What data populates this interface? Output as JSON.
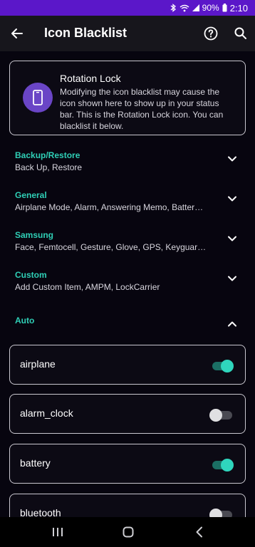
{
  "status": {
    "battery_percent": "90%",
    "time": "2:10",
    "icons": [
      "bluetooth-icon",
      "wifi-icon",
      "signal-icon",
      "battery-icon"
    ]
  },
  "appbar": {
    "title": "Icon Blacklist",
    "back_icon": "arrow-back-icon",
    "help_icon": "help-circle-icon",
    "search_icon": "search-icon"
  },
  "info_card": {
    "title": "Rotation Lock",
    "body": "Modifying the icon blacklist may cause the icon shown here to show up in your status bar. This is the Rotation Lock icon. You can blacklist it below.",
    "icon": "phone-rotation-icon",
    "accent": "#6a45c6"
  },
  "sections": [
    {
      "title": "Backup/Restore",
      "subtitle": "Back Up, Restore",
      "expanded": false
    },
    {
      "title": "General",
      "subtitle": "Airplane Mode, Alarm, Answering Memo, Batter…",
      "expanded": false
    },
    {
      "title": "Samsung",
      "subtitle": "Face, Femtocell, Gesture, Glove, GPS, Keyguard…",
      "expanded": false
    },
    {
      "title": "Custom",
      "subtitle": "Add Custom Item, AMPM, LockCarrier",
      "expanded": false
    },
    {
      "title": "Auto",
      "subtitle": "",
      "expanded": true
    }
  ],
  "items": [
    {
      "label": "airplane",
      "on": true
    },
    {
      "label": "alarm_clock",
      "on": false
    },
    {
      "label": "battery",
      "on": true
    },
    {
      "label": "bluetooth",
      "on": false
    }
  ],
  "navbar": {
    "icons": [
      "recents-icon",
      "home-icon",
      "back-icon"
    ]
  },
  "colors": {
    "status_bar": "#5b17c9",
    "accent": "#2fcfb6",
    "background": "#07050f"
  }
}
